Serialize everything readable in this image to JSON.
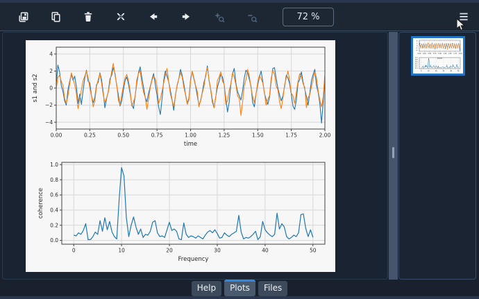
{
  "toolbar": {
    "zoom_level": "72 %",
    "icons": [
      "save-plot-icon",
      "copy-image-icon",
      "remove-plot-icon",
      "remove-all-plots-icon",
      "previous-plot-icon",
      "next-plot-icon",
      "zoom-in-icon",
      "zoom-out-icon",
      "options-menu-icon"
    ]
  },
  "tabs": [
    {
      "label": "Help",
      "active": false
    },
    {
      "label": "Plots",
      "active": true
    },
    {
      "label": "Files",
      "active": false
    }
  ],
  "colors": {
    "accent_blue": "#2f87e1",
    "thumbnail_selection": "#2173c4",
    "toolbar_bg": "#1d2734",
    "pane_bg": "#1a2331",
    "series_blue": "#1f77b4",
    "series_orange": "#ff7f0e"
  },
  "chart_data": [
    {
      "type": "line",
      "title": "",
      "xlabel": "time",
      "ylabel": "s1 and s2",
      "xlim": [
        0,
        2
      ],
      "ylim": [
        -4.8,
        4.8
      ],
      "xticks": [
        0,
        0.25,
        0.5,
        0.75,
        1.0,
        1.25,
        1.5,
        1.75,
        2.0
      ],
      "xtick_labels": [
        "0.00",
        "0.25",
        "0.50",
        "0.75",
        "1.00",
        "1.25",
        "1.50",
        "1.75",
        "2.00"
      ],
      "yticks": [
        -4,
        -2,
        0,
        2,
        4
      ],
      "ytick_labels": [
        "−4",
        "−2",
        "0",
        "2",
        "4"
      ],
      "grid": true,
      "grid_color": "#d7d7d7",
      "spine_color": "#424242",
      "text_color": "#2b2b2b",
      "legend": "none",
      "series": [
        {
          "name": "s1",
          "color": "#1f77b4",
          "x_start": 0,
          "x_step": 0.0125,
          "values": [
            0.5,
            2.7,
            1.9,
            0.3,
            -0.4,
            -1.5,
            -2.0,
            -0.2,
            0.8,
            1.6,
            0.9,
            1.4,
            0.2,
            -1.8,
            -0.7,
            -1.9,
            -0.3,
            1.2,
            2.1,
            0.8,
            0.6,
            -0.9,
            -1.7,
            -1.1,
            0.4,
            0.7,
            1.8,
            1.0,
            -0.5,
            -2.3,
            -1.2,
            -0.4,
            1.1,
            1.5,
            2.4,
            1.7,
            0.3,
            -0.8,
            -2.1,
            -1.5,
            -0.2,
            0.9,
            1.3,
            0.5,
            -0.6,
            -1.9,
            -2.4,
            -0.9,
            0.6,
            1.8,
            2.5,
            1.2,
            0.1,
            -1.1,
            -1.6,
            -0.6,
            0.2,
            1.0,
            1.7,
            0.4,
            -0.8,
            -2.2,
            -3.1,
            -1.3,
            0.9,
            2.0,
            1.4,
            0.7,
            -0.3,
            -1.4,
            -2.6,
            -0.8,
            0.3,
            1.1,
            2.2,
            1.5,
            0.5,
            -0.7,
            -1.8,
            -1.2,
            1.0,
            1.9,
            1.1,
            0.2,
            -0.9,
            -2.0,
            -1.5,
            -0.5,
            0.7,
            1.4,
            2.6,
            0.9,
            -0.2,
            -1.6,
            -2.3,
            -1.0,
            0.1,
            0.8,
            1.6,
            1.3,
            0.4,
            -1.2,
            -2.8,
            -1.7,
            0.5,
            1.7,
            2.3,
            0.6,
            -0.4,
            -0.9,
            -1.4,
            -0.3,
            1.2,
            2.1,
            1.8,
            1.0,
            0.2,
            -1.7,
            -2.2,
            -0.7,
            0.4,
            1.3,
            2.0,
            0.8,
            -0.6,
            -1.3,
            -1.9,
            -1.1,
            0.8,
            2.3,
            2.4,
            1.1,
            0.0,
            -0.8,
            -1.5,
            -0.9,
            0.2,
            1.5,
            1.2,
            0.5,
            -0.7,
            -2.1,
            -2.5,
            -1.4,
            0.6,
            1.0,
            1.9,
            0.7,
            -0.1,
            -1.0,
            -2.0,
            -0.6,
            0.9,
            1.6,
            2.2,
            0.3,
            -0.5,
            -1.8,
            -4.1,
            -1.6,
            1.4
          ]
        },
        {
          "name": "s2",
          "color": "#ff7f0e",
          "x_start": 0,
          "x_step": 0.0125,
          "values": [
            -0.1,
            1.3,
            1.5,
            0.8,
            0.3,
            -1.2,
            -1.8,
            -0.9,
            0.5,
            1.8,
            1.1,
            0.4,
            -0.6,
            -2.4,
            -1.3,
            -0.2,
            0.9,
            1.4,
            2.0,
            1.2,
            0.0,
            -0.9,
            -2.2,
            -1.5,
            0.2,
            1.0,
            1.7,
            0.6,
            -0.8,
            -1.7,
            -1.1,
            -0.5,
            0.7,
            1.9,
            2.9,
            1.5,
            0.4,
            -1.4,
            -2.0,
            -0.8,
            0.3,
            1.2,
            1.6,
            0.9,
            -0.3,
            -2.1,
            -1.6,
            -1.0,
            1.0,
            1.7,
            2.1,
            0.5,
            -0.5,
            -1.1,
            -2.5,
            -1.3,
            0.1,
            0.9,
            1.4,
            1.1,
            0.2,
            -1.8,
            -1.2,
            -0.4,
            0.6,
            1.5,
            2.3,
            0.7,
            -0.7,
            -1.5,
            -2.1,
            -0.9,
            0.4,
            1.1,
            1.8,
            1.3,
            0.1,
            -0.8,
            -1.9,
            -1.4,
            0.8,
            2.0,
            1.2,
            0.3,
            -0.4,
            -2.2,
            -1.4,
            -0.6,
            0.2,
            1.6,
            2.4,
            1.0,
            -0.1,
            -1.3,
            -2.3,
            -1.1,
            0.9,
            1.3,
            1.9,
            0.8,
            0.5,
            -1.9,
            -1.5,
            -0.3,
            0.5,
            1.8,
            1.3,
            0.4,
            -0.9,
            -1.2,
            -3.2,
            -1.6,
            0.3,
            1.0,
            2.2,
            1.4,
            0.0,
            -1.0,
            -1.7,
            -0.7,
            0.7,
            1.5,
            1.1,
            0.6,
            -0.5,
            -2.0,
            -1.3,
            -0.9,
            1.1,
            2.1,
            1.6,
            0.2,
            -0.2,
            -1.6,
            -2.4,
            -1.2,
            0.4,
            1.2,
            2.0,
            0.9,
            -0.6,
            -0.9,
            -1.8,
            -0.5,
            0.8,
            1.7,
            1.4,
            0.5,
            0.1,
            -2.3,
            -1.1,
            -0.8,
            0.2,
            1.1,
            1.9,
            1.2,
            -0.3,
            -1.4,
            -2.2,
            -1.0,
            1.6
          ]
        }
      ]
    },
    {
      "type": "line",
      "title": "",
      "xlabel": "Frequency",
      "ylabel": "coherence",
      "xlim": [
        -2.5,
        52.5
      ],
      "ylim": [
        -0.05,
        1.03
      ],
      "xticks": [
        0,
        10,
        20,
        30,
        40,
        50
      ],
      "xtick_labels": [
        "0",
        "10",
        "20",
        "30",
        "40",
        "50"
      ],
      "yticks": [
        0,
        0.2,
        0.4,
        0.6,
        0.8,
        1.0
      ],
      "ytick_labels": [
        "0.0",
        "0.2",
        "0.4",
        "0.6",
        "0.8",
        "1.0"
      ],
      "grid": true,
      "grid_color": "#d7d7d7",
      "spine_color": "#424242",
      "text_color": "#2b2b2b",
      "legend": "none",
      "series": [
        {
          "name": "coherence",
          "color": "#1f77b4",
          "x_start": 0,
          "x_step": 0.5,
          "values": [
            0.07,
            0.06,
            0.1,
            0.08,
            0.13,
            0.22,
            0.01,
            0.01,
            0.05,
            0.11,
            0.08,
            0.26,
            0.12,
            0.3,
            0.14,
            0.25,
            0.11,
            0.05,
            0.02,
            0.55,
            0.96,
            0.85,
            0.3,
            0.05,
            0.2,
            0.31,
            0.18,
            0.08,
            0.15,
            0.04,
            0.08,
            0.07,
            0.12,
            0.24,
            0.26,
            0.1,
            0.05,
            0.06,
            0.04,
            0.14,
            0.24,
            0.13,
            0.15,
            0.12,
            0.02,
            0.01,
            0.23,
            0.08,
            0.04,
            0.06,
            0.05,
            0.03,
            0.06,
            0.04,
            0.02,
            0.07,
            0.11,
            0.13,
            0.1,
            0.14,
            0.09,
            0.03,
            0.04,
            0.1,
            0.07,
            0.05,
            0.08,
            0.1,
            0.12,
            0.33,
            0.11,
            0.02,
            0.04,
            0.03,
            0.05,
            0.08,
            0.12,
            0.01,
            0.05,
            0.25,
            0.14,
            0.1,
            0.07,
            0.05,
            0.08,
            0.36,
            0.15,
            0.22,
            0.18,
            0.05,
            0.02,
            0.04,
            0.07,
            0.05,
            0.1,
            0.34,
            0.35,
            0.16,
            0.05,
            0.14,
            0.04
          ]
        }
      ]
    }
  ]
}
